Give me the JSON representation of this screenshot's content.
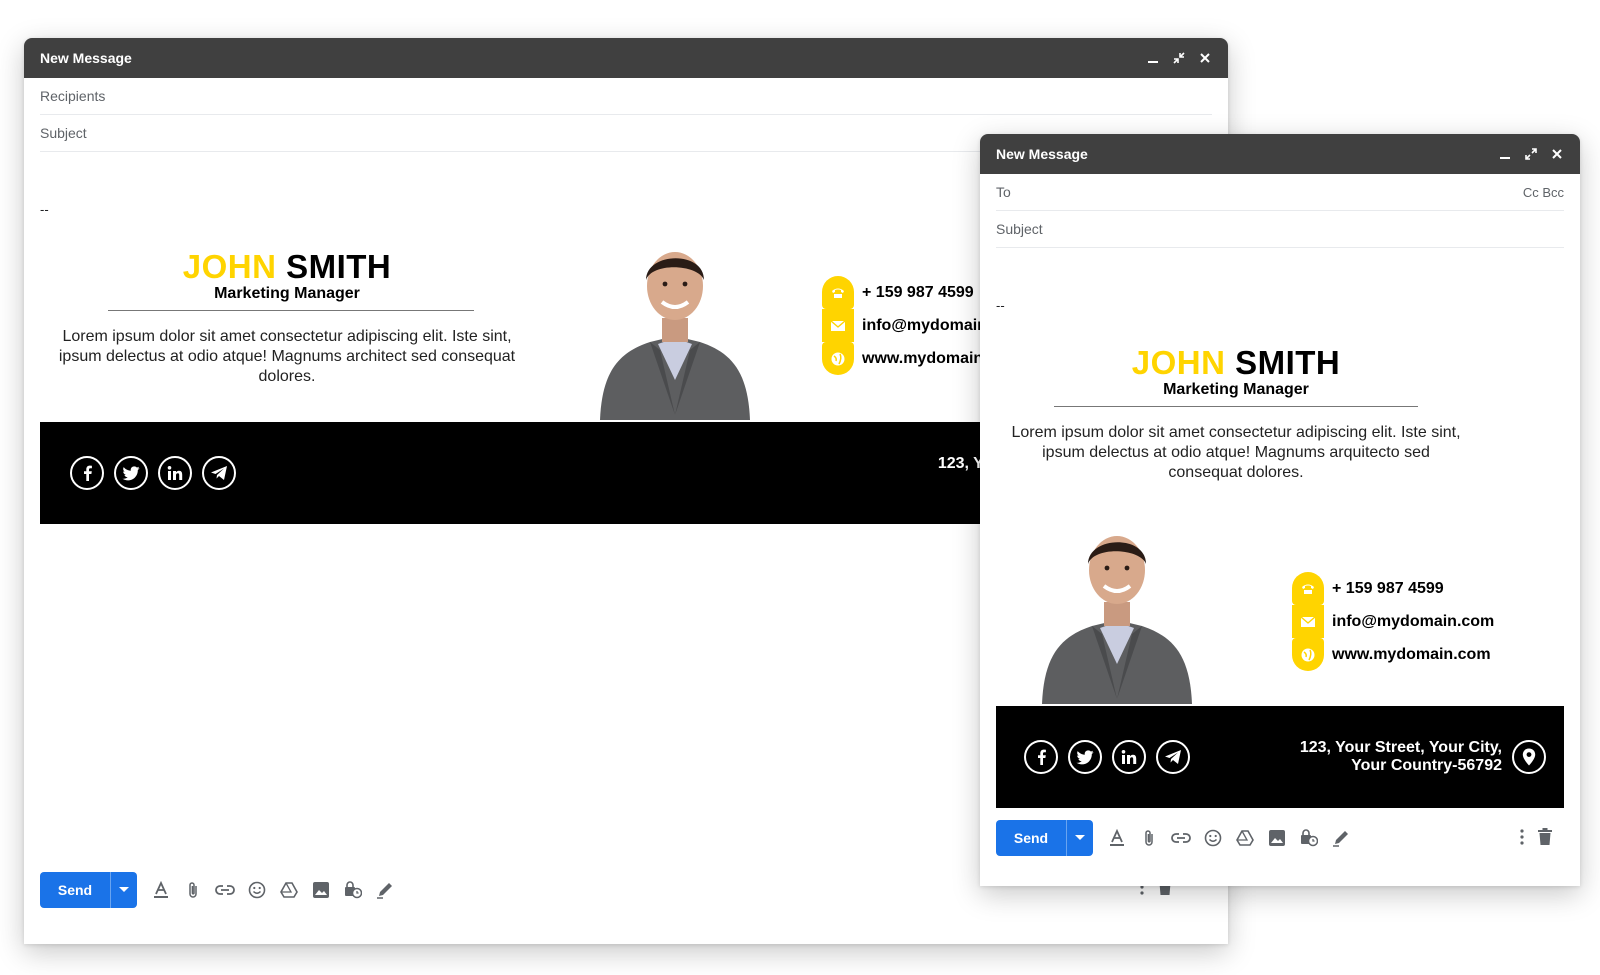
{
  "back_window": {
    "title": "New Message",
    "recipients_placeholder": "Recipients",
    "subject_placeholder": "Subject",
    "dash": "--",
    "send_label": "Send"
  },
  "front_window": {
    "title": "New Message",
    "to_placeholder": "To",
    "cc_bcc": "Cc Bcc",
    "subject_placeholder": "Subject",
    "dash": "--",
    "send_label": "Send"
  },
  "signature": {
    "first_name": "JOHN",
    "last_name": "SMITH",
    "title": "Marketing Manager",
    "bio_back": "Lorem ipsum dolor sit amet consectetur adipiscing elit. Iste sint, ipsum delectus at odio atque! Magnums architect sed consequat dolores.",
    "bio_front": "Lorem ipsum dolor sit amet consectetur adipiscing elit. Iste sint, ipsum delectus at odio atque! Magnums arquitecto sed consequat dolores.",
    "phone": "+ 159 987 4599",
    "email": "info@mydomain.com",
    "website": "www.mydomain.com",
    "address_line1": "123, Your Street, Your City,",
    "address_line2": "Your Country-56792",
    "accent_color": "#ffd400",
    "footer_color": "#000000"
  },
  "icons": {
    "contacts": [
      "phone-icon",
      "mail-icon",
      "globe-icon"
    ],
    "socials": [
      "facebook-icon",
      "twitter-icon",
      "linkedin-icon",
      "telegram-icon"
    ],
    "toolbar": [
      "format-text-icon",
      "attach-icon",
      "link-icon",
      "emoji-icon",
      "drive-icon",
      "image-icon",
      "confidential-icon",
      "signature-icon"
    ]
  },
  "colors": {
    "titlebar": "#404040",
    "send_button": "#1a73e8"
  }
}
